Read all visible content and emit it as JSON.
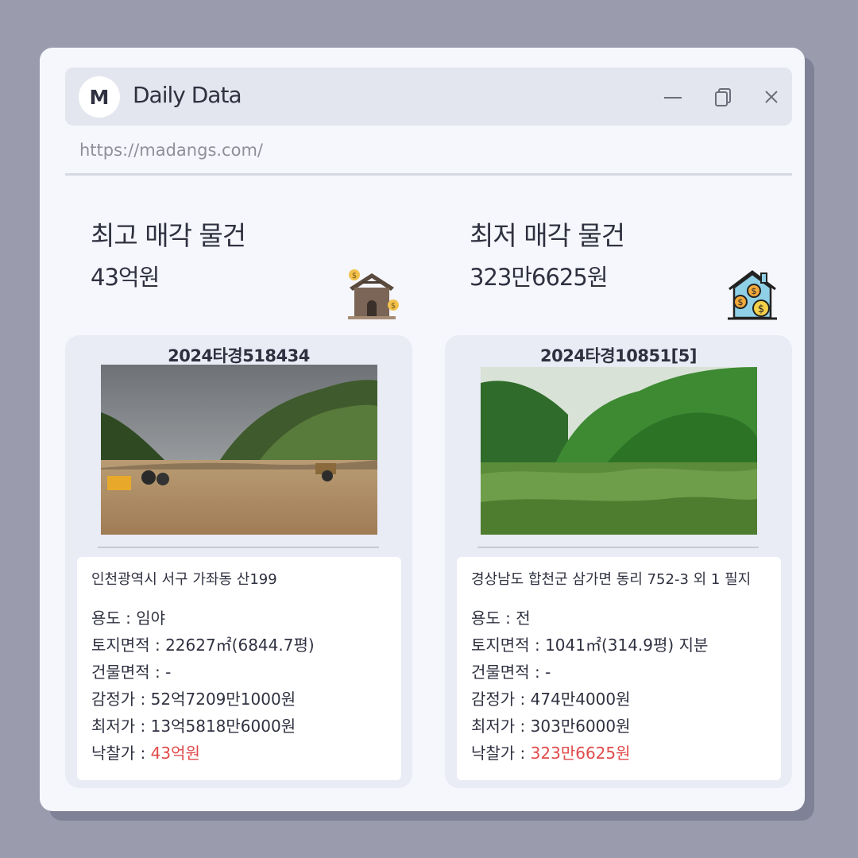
{
  "window": {
    "avatar_letter": "M",
    "title": "Daily Data",
    "url": "https://madangs.com/",
    "controls": [
      "minimize-icon",
      "restore-icon",
      "close-icon"
    ]
  },
  "highest": {
    "heading": "최고 매각 물건",
    "amount": "43억원",
    "icon": "house-coins-icon",
    "case_no": "2024타경518434",
    "address": "인천광역시 서구 가좌동 산199",
    "rows": [
      {
        "label": "용도 : ",
        "value": "임야"
      },
      {
        "label": "토지면적 : ",
        "value": "22627㎡(6844.7평)"
      },
      {
        "label": "건물면적 : ",
        "value": "-"
      },
      {
        "label": "감정가 : ",
        "value": "52억7209만1000원"
      },
      {
        "label": "최저가 : ",
        "value": "13억5818만6000원"
      },
      {
        "label": "낙찰가 : ",
        "value": "43억원"
      }
    ]
  },
  "lowest": {
    "heading": "최저 매각 물건",
    "amount": "323만6625원",
    "icon": "house-coins-icon",
    "case_no": "2024타경10851[5]",
    "address": "경상남도 합천군 삼가면 동리 752-3 외 1 필지",
    "rows": [
      {
        "label": "용도 : ",
        "value": "전"
      },
      {
        "label": "토지면적 : ",
        "value": "1041㎡(314.9평) 지분"
      },
      {
        "label": "건물면적 : ",
        "value": "-"
      },
      {
        "label": "감정가 : ",
        "value": "474만4000원"
      },
      {
        "label": "최저가 : ",
        "value": "303만6000원"
      },
      {
        "label": "낙찰가 : ",
        "value": "323만6625원"
      }
    ]
  },
  "colors": {
    "background": "#9a9cae",
    "window": "#f6f7fc",
    "card": "#e9ebf5",
    "highlight": "#e04a4a"
  }
}
